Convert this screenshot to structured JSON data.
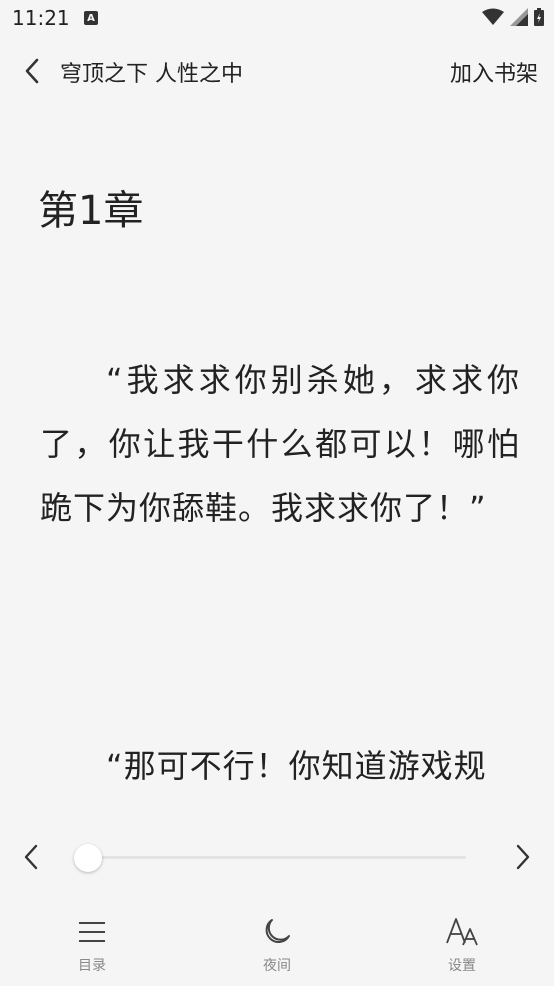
{
  "status_bar": {
    "time": "11:21",
    "notification_icon": "A"
  },
  "header": {
    "book_title": "穹顶之下 人性之中",
    "add_to_shelf": "加入书架"
  },
  "content": {
    "chapter_title": "第1章",
    "paragraphs": [
      "“我求求你别杀她，求求你了，你让我干什么都可以！哪怕跪下为你舔鞋。我求求你了！”",
      "“那可不行！你知道游戏规"
    ]
  },
  "progress": {
    "value": 0.0
  },
  "bottom_nav": {
    "toc_label": "目录",
    "night_label": "夜间",
    "settings_label": "设置"
  }
}
